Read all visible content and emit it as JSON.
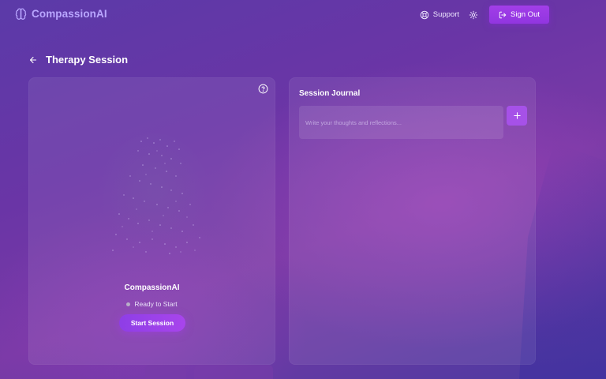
{
  "header": {
    "brand_name": "CompassionAI",
    "support_label": "Support",
    "sign_out_label": "Sign Out",
    "icons": [
      "brain-icon",
      "lifebuoy-icon",
      "gear-icon",
      "sign-out-icon"
    ]
  },
  "page": {
    "title": "Therapy Session",
    "back_icon": "arrow-left-icon"
  },
  "session_panel": {
    "help_icon": "question-circle-icon",
    "agent_name": "CompassionAI",
    "status_text": "Ready to Start",
    "start_button_label": "Start Session"
  },
  "journal_panel": {
    "title": "Session Journal",
    "input_placeholder": "Write your thoughts and reflections...",
    "input_value": "",
    "add_icon": "plus-icon"
  },
  "colors": {
    "accent": "#9b3fe6",
    "brand_text": "#b9a6ff",
    "status_dot": "#b8b0c8"
  }
}
